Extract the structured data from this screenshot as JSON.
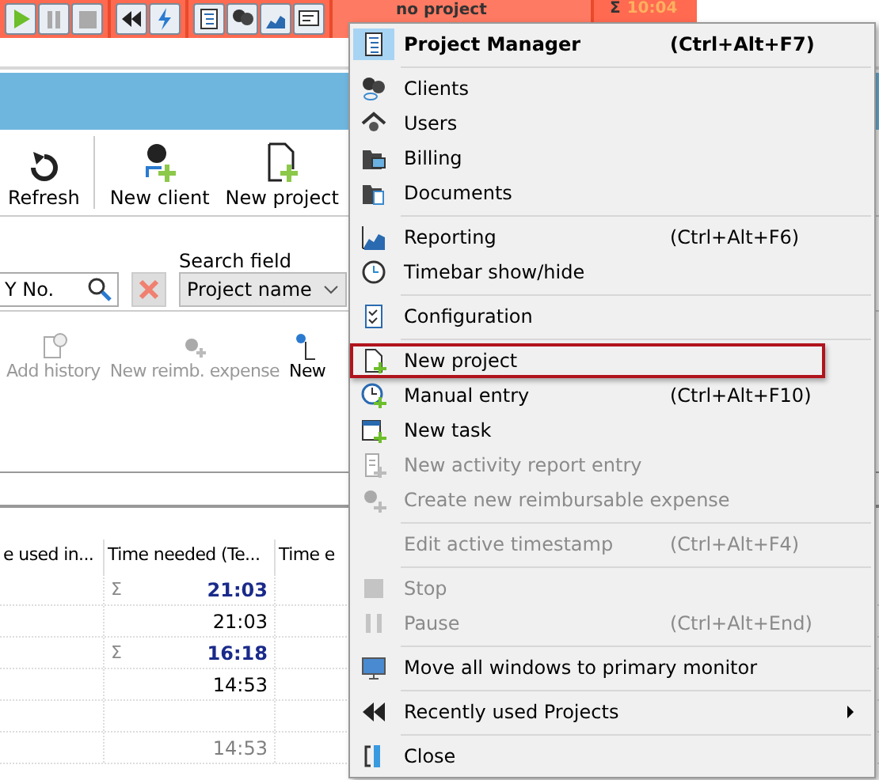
{
  "timebar": {
    "project": "no project",
    "sum_symbol": "Σ",
    "sum_time": "10:04"
  },
  "toolbar": [
    {
      "label": "Refresh"
    },
    {
      "label": "New client"
    },
    {
      "label": "New project"
    }
  ],
  "search": {
    "value": "Y No.",
    "field_label": "Search field",
    "field_value": "Project name"
  },
  "actions": [
    {
      "label": "Add history",
      "disabled": true
    },
    {
      "label": "New reimb. expense",
      "disabled": true
    },
    {
      "label": "New",
      "disabled": false
    }
  ],
  "table": {
    "columns": [
      "e used in...",
      "Time needed (Te...",
      "Time e"
    ],
    "rows": [
      {
        "sigma": "Σ",
        "value": "21:03",
        "total": true,
        "dim": false
      },
      {
        "value": "21:03",
        "total": false,
        "dim": false
      },
      {
        "sigma": "Σ",
        "value": "16:18",
        "total": true,
        "dim": false
      },
      {
        "value": "14:53",
        "total": false,
        "dim": false
      },
      {},
      {
        "value": "14:53",
        "total": false,
        "dim": true
      }
    ]
  },
  "menu": [
    {
      "kind": "item",
      "label": "Project Manager",
      "shortcut": "(Ctrl+Alt+F7)",
      "bold": true,
      "disabled": false,
      "selected": false
    },
    {
      "kind": "separator"
    },
    {
      "kind": "item",
      "label": "Clients",
      "disabled": false,
      "selected": false
    },
    {
      "kind": "item",
      "label": "Users",
      "disabled": false,
      "selected": false
    },
    {
      "kind": "item",
      "label": "Billing",
      "disabled": false,
      "selected": false
    },
    {
      "kind": "item",
      "label": "Documents",
      "disabled": false,
      "selected": false
    },
    {
      "kind": "separator"
    },
    {
      "kind": "item",
      "label": "Reporting",
      "shortcut": "(Ctrl+Alt+F6)",
      "disabled": false,
      "selected": false
    },
    {
      "kind": "item",
      "label": "Timebar show/hide",
      "disabled": false,
      "selected": false
    },
    {
      "kind": "separator"
    },
    {
      "kind": "item",
      "label": "Configuration",
      "disabled": false,
      "selected": false
    },
    {
      "kind": "separator"
    },
    {
      "kind": "item",
      "label": "New project",
      "disabled": false,
      "selected": true
    },
    {
      "kind": "item",
      "label": "Manual entry",
      "shortcut": "(Ctrl+Alt+F10)",
      "disabled": false,
      "selected": false
    },
    {
      "kind": "item",
      "label": "New task",
      "disabled": false,
      "selected": false
    },
    {
      "kind": "item",
      "label": "New activity report entry",
      "disabled": true,
      "selected": false
    },
    {
      "kind": "item",
      "label": "Create new reimbursable expense",
      "disabled": true,
      "selected": false
    },
    {
      "kind": "separator"
    },
    {
      "kind": "item",
      "label": "Edit active timestamp",
      "shortcut": "(Ctrl+Alt+F4)",
      "disabled": true,
      "selected": false
    },
    {
      "kind": "separator"
    },
    {
      "kind": "item",
      "label": "Stop",
      "disabled": true,
      "selected": false
    },
    {
      "kind": "item",
      "label": "Pause",
      "shortcut": "(Ctrl+Alt+End)",
      "disabled": true,
      "selected": false
    },
    {
      "kind": "separator"
    },
    {
      "kind": "item",
      "label": "Move all windows to primary monitor",
      "disabled": false,
      "selected": false
    },
    {
      "kind": "separator"
    },
    {
      "kind": "item",
      "label": "Recently used Projects",
      "submenu": true,
      "disabled": false,
      "selected": false
    },
    {
      "kind": "separator"
    },
    {
      "kind": "item",
      "label": "Close",
      "disabled": false,
      "selected": false
    }
  ]
}
